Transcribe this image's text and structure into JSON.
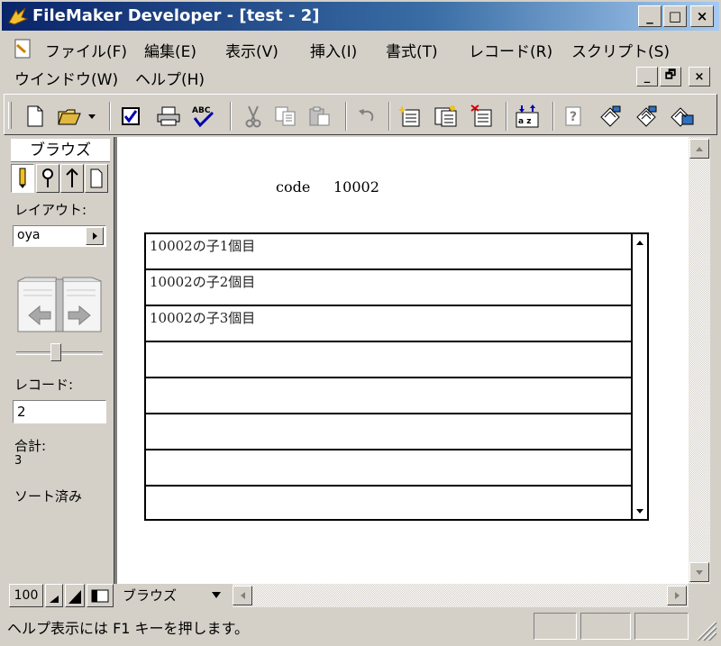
{
  "window": {
    "title": "FileMaker Developer - [test - 2]",
    "minimize": "_",
    "maximize": "□",
    "close": "×"
  },
  "menu": {
    "row1": [
      "ファイル(F)",
      "編集(E)",
      "表示(V)",
      "挿入(I)",
      "書式(T)",
      "レコード(R)",
      "スクリプト(S)"
    ],
    "row2": [
      "ウインドウ(W)",
      "ヘルプ(H)"
    ],
    "mdi_min": "_",
    "mdi_restore": "🗗",
    "mdi_close": "×"
  },
  "toolbar": {
    "icons": [
      "new-file-icon",
      "open-folder-icon",
      "dropdown-icon",
      "checkbox-icon",
      "print-icon",
      "spellcheck-icon",
      "cut-icon",
      "copy-icon",
      "paste-icon",
      "undo-icon",
      "new-record-icon",
      "duplicate-record-icon",
      "delete-record-icon",
      "sort-icon",
      "help-icon",
      "script-icon",
      "script-run-icon",
      "script-debug-icon"
    ],
    "spell_label": "ABC"
  },
  "status_area": {
    "mode_title": "ブラウズ",
    "layout_label": "レイアウト:",
    "layout_value": "oya",
    "record_label": "レコード:",
    "record_value": "2",
    "total_label": "合計:",
    "total_value": "3",
    "sorted_label": "ソート済み",
    "slider_position": 0.45
  },
  "content": {
    "code_label": "code",
    "code_value": "10002",
    "portal_rows": [
      "10002の子1個目",
      "10002の子2個目",
      "10002の子3個目",
      "",
      "",
      "",
      "",
      ""
    ]
  },
  "bottom_bar": {
    "zoom": "100",
    "mode_select": "ブラウズ"
  },
  "statusbar": {
    "help_text": "ヘルプ表示には F1 キーを押します。"
  },
  "colors": {
    "titlebar_start": "#0a246a",
    "titlebar_end": "#a6caf0",
    "face": "#d4d0c8"
  }
}
